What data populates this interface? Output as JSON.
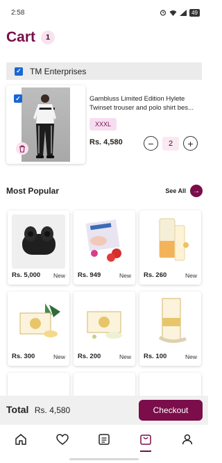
{
  "status_bar": {
    "time": "2:58",
    "battery": "49"
  },
  "cart": {
    "title": "Cart",
    "count": "1"
  },
  "seller": {
    "name": "TM Enterprises"
  },
  "item": {
    "name": "Gambluss Limited Edition Hylete Twinset trouser and polo shirt bes...",
    "size": "XXXL",
    "price": "Rs. 4,580",
    "quantity": "2",
    "minus": "−",
    "plus": "+"
  },
  "most_popular": {
    "title": "Most Popular",
    "see_all": "See All",
    "products": [
      {
        "price": "Rs. 5,000",
        "tag": "New"
      },
      {
        "price": "Rs. 949",
        "tag": "New"
      },
      {
        "price": "Rs. 260",
        "tag": "New"
      },
      {
        "price": "Rs. 300",
        "tag": "New"
      },
      {
        "price": "Rs. 200",
        "tag": "New"
      },
      {
        "price": "Rs. 100",
        "tag": "New"
      }
    ]
  },
  "footer": {
    "total_label": "Total",
    "total_value": "Rs. 4,580",
    "checkout": "Checkout"
  },
  "nav": [
    "home-icon",
    "heart-icon",
    "orders-icon",
    "cart-icon",
    "profile-icon"
  ],
  "colors": {
    "accent": "#7a0d4a",
    "accent_light": "#fbe1ee",
    "checkbox": "#1766d6"
  }
}
